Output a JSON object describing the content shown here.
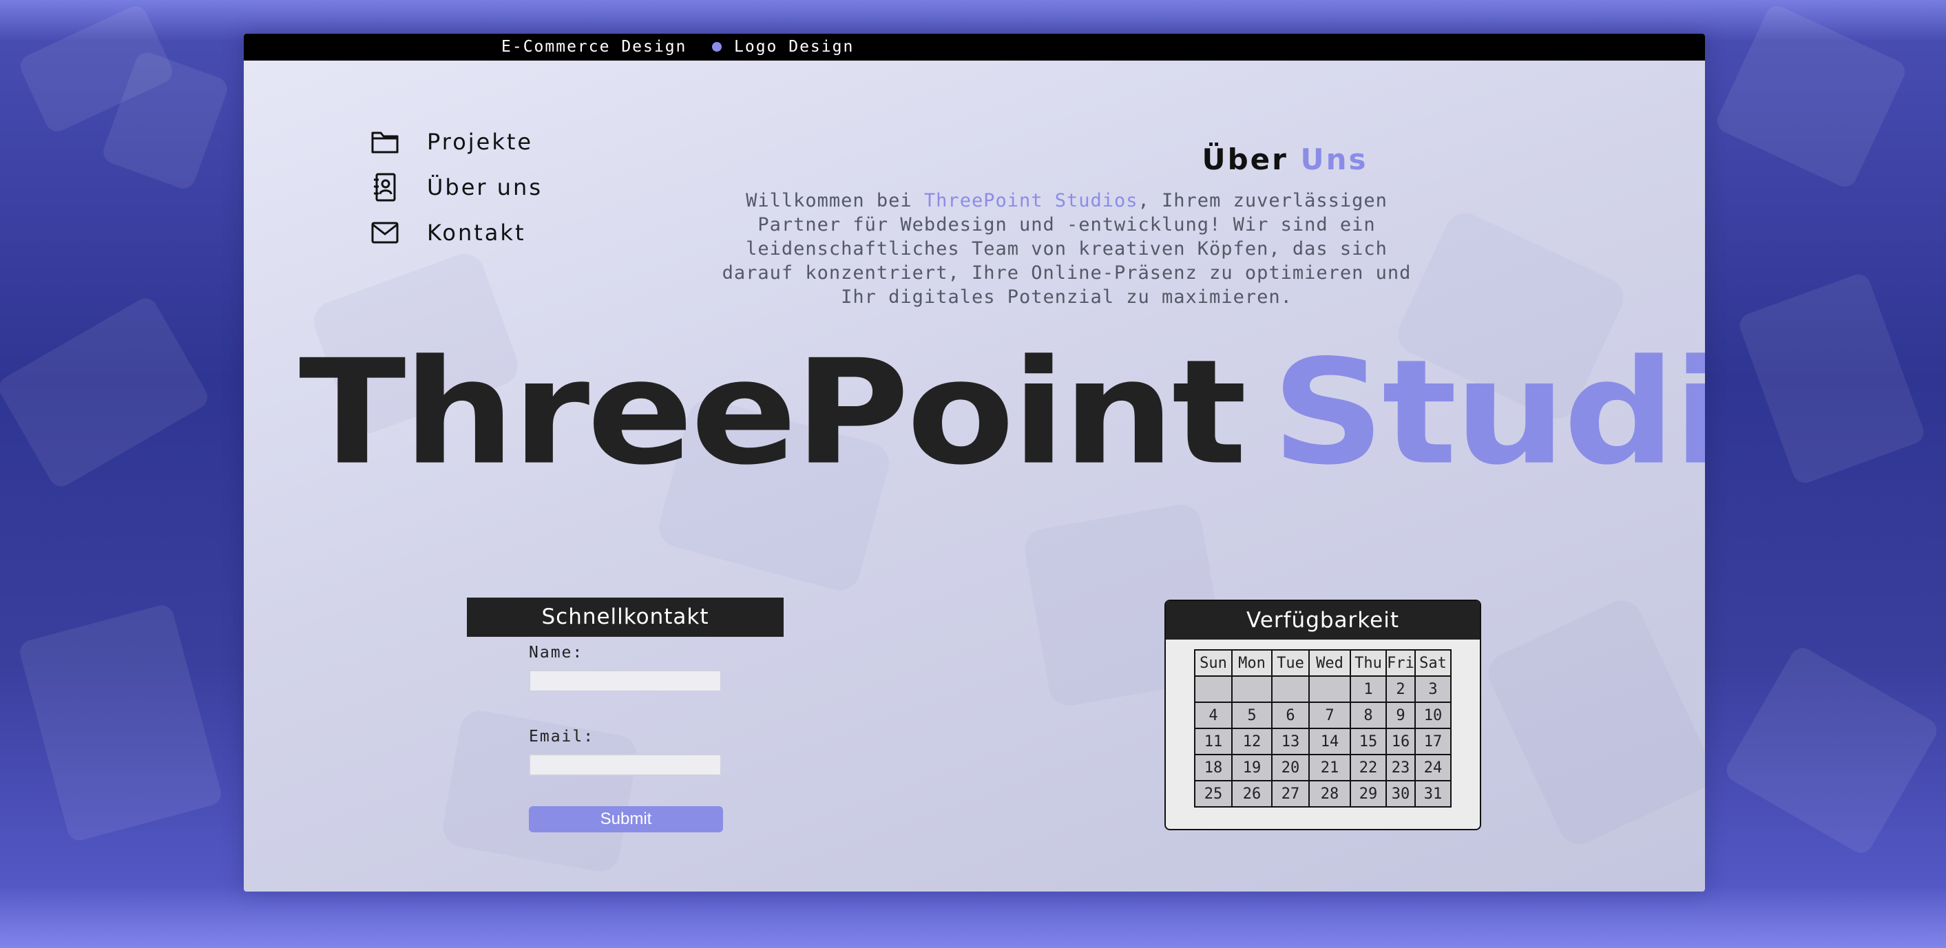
{
  "colors": {
    "accent": "#8a8de6",
    "dark": "#222222",
    "topbar": "#000000",
    "panel": "#d6d7ec"
  },
  "topbar": {
    "items": [
      {
        "label": "E-Commerce Design",
        "marker": false
      },
      {
        "label": "Logo Design",
        "marker": true
      }
    ]
  },
  "nav": {
    "items": [
      {
        "label": "Projekte",
        "icon": "folder-icon"
      },
      {
        "label": "Über uns",
        "icon": "contact-book-icon"
      },
      {
        "label": "Kontakt",
        "icon": "mail-icon"
      }
    ]
  },
  "about": {
    "title_plain": "Über",
    "title_accent": "Uns",
    "text_before": "Willkommen bei",
    "brand": "ThreePoint Studios",
    "text_after": ", Ihrem zuverlässigen Partner für Webdesign und -entwicklung! Wir sind ein leidenschaftliches Team von kreativen Köpfen, das sich darauf konzentriert, Ihre Online-Präsenz zu optimieren und Ihr digitales Potenzial zu maximieren."
  },
  "hero": {
    "word1": "ThreePoint",
    "word2": "Studios"
  },
  "contact": {
    "title": "Schnellkontakt",
    "name_label": "Name:",
    "name_value": "",
    "email_label": "Email:",
    "email_value": "",
    "submit_label": "Submit"
  },
  "availability": {
    "title": "Verfügbarkeit",
    "weekdays": [
      "Sun",
      "Mon",
      "Tue",
      "Wed",
      "Thu",
      "Fri",
      "Sat"
    ],
    "weeks": [
      [
        "",
        "",
        "",
        "",
        "1",
        "2",
        "3"
      ],
      [
        "4",
        "5",
        "6",
        "7",
        "8",
        "9",
        "10"
      ],
      [
        "11",
        "12",
        "13",
        "14",
        "15",
        "16",
        "17"
      ],
      [
        "18",
        "19",
        "20",
        "21",
        "22",
        "23",
        "24"
      ],
      [
        "25",
        "26",
        "27",
        "28",
        "29",
        "30",
        "31"
      ]
    ]
  }
}
